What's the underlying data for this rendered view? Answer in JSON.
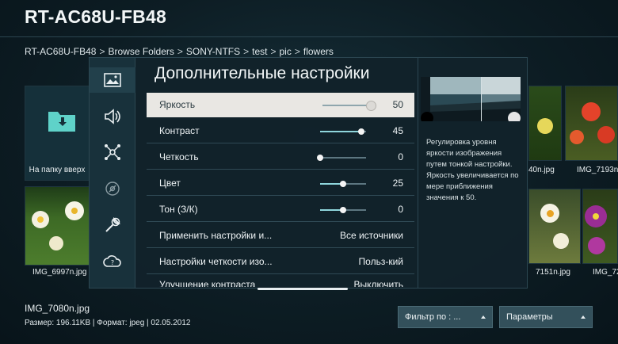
{
  "header": {
    "title": "RT-AC68U-FB48"
  },
  "breadcrumb": [
    "RT-AC68U-FB48",
    "Browse Folders",
    "SONY-NTFS",
    "test",
    "pic",
    "flowers"
  ],
  "breadcrumb_sep": ">",
  "grid": {
    "folder_label": "На папку вверх",
    "left_image_label": "IMG_6997n.jpg",
    "right_labels": [
      "40n.jpg",
      "IMG_7193n.",
      "7151n.jpg",
      "IMG_72"
    ]
  },
  "settings_panel": {
    "title": "Дополнительные настройки",
    "sidebar_icons": [
      "picture-icon",
      "sound-icon",
      "network-icon",
      "broadcast-icon",
      "wrench-icon",
      "cloud-support-icon"
    ],
    "rows": [
      {
        "label": "Яркость",
        "value": "50",
        "slider": 0.9
      },
      {
        "label": "Контраст",
        "value": "45",
        "slider": 0.9
      },
      {
        "label": "Четкость",
        "value": "0",
        "slider": 0.0
      },
      {
        "label": "Цвет",
        "value": "25",
        "slider": 0.5
      },
      {
        "label": "Тон (З/К)",
        "value": "0",
        "slider": 0.5
      },
      {
        "label": "Применить настройки и...",
        "value": "Все источники"
      },
      {
        "label": "Настройки четкости изо...",
        "value": "Польз-кий"
      },
      {
        "label": "Улучшение контраста",
        "value": "Выключить"
      }
    ],
    "description": "Регулировка уровня яркости изображения путем тонкой настройки. Яркость увеличивается по мере приближения значения к 50."
  },
  "footer": {
    "file_name": "IMG_7080n.jpg",
    "file_info": "Размер: 196.11KB | Формат: jpeg | 02.05.2012",
    "filter_label": "Фильтр по : ...",
    "options_label": "Параметры"
  }
}
